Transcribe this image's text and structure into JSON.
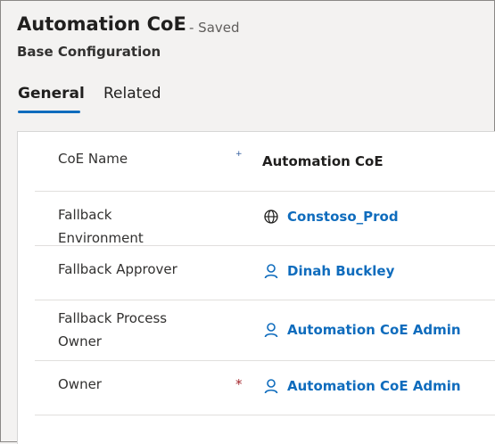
{
  "header": {
    "title": "Automation CoE",
    "status": "- Saved",
    "subtitle": "Base Configuration"
  },
  "tabs": [
    {
      "label": "General",
      "active": true
    },
    {
      "label": "Related",
      "active": false
    }
  ],
  "fields": [
    {
      "label": "CoE Name",
      "required_marker": "+",
      "value": "Automation CoE"
    },
    {
      "label": "Fallback Environment",
      "required_marker": "",
      "value": "Constoso_Prod",
      "icon": "globe-icon"
    },
    {
      "label": "Fallback Approver",
      "required_marker": "",
      "value": "Dinah Buckley",
      "icon": "person-icon"
    },
    {
      "label": "Fallback Process Owner",
      "required_marker": "",
      "value": "Automation CoE Admin",
      "icon": "person-icon"
    },
    {
      "label": "Owner",
      "required_marker": "*",
      "value": "Automation CoE Admin",
      "icon": "person-icon"
    }
  ],
  "colors": {
    "accent": "#0f6cbd",
    "required": "#a4262c",
    "link": "#0f6cbd"
  }
}
